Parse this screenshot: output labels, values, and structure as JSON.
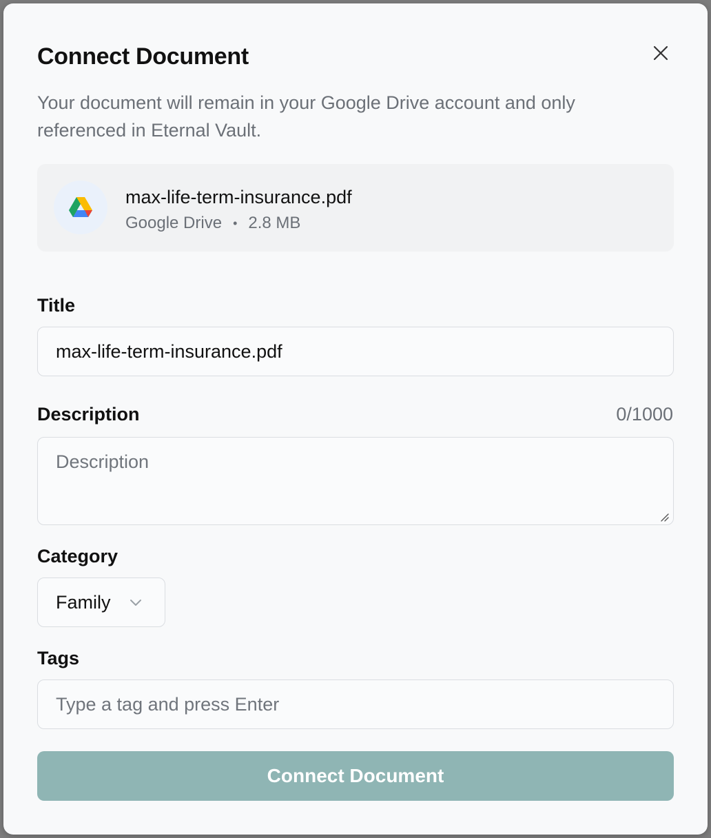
{
  "dialog": {
    "title": "Connect Document",
    "subtitle": "Your document will remain in your Google Drive account and only referenced in Eternal Vault.",
    "close_icon": "close-icon"
  },
  "file": {
    "name": "max-life-term-insurance.pdf",
    "source": "Google Drive",
    "separator": "•",
    "size": "2.8 MB",
    "icon": "google-drive-icon"
  },
  "form": {
    "title_label": "Title",
    "title_value": "max-life-term-insurance.pdf",
    "description_label": "Description",
    "description_counter": "0/1000",
    "description_placeholder": "Description",
    "category_label": "Category",
    "category_value": "Family",
    "tags_label": "Tags",
    "tags_placeholder": "Type a tag and press Enter",
    "submit_label": "Connect Document"
  },
  "colors": {
    "submit_bg": "#8fb5b4",
    "text_primary": "#111111",
    "text_muted": "#6b7077"
  }
}
